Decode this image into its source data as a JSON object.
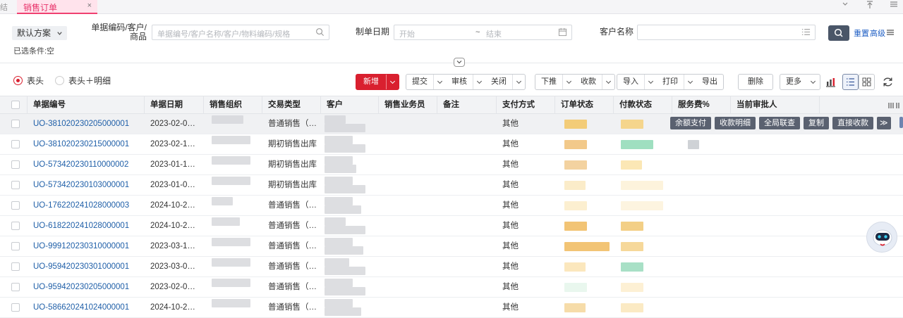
{
  "tabbar": {
    "prev_label": "结",
    "active_tab": "销售订单",
    "close": "×"
  },
  "filters": {
    "scheme": "默认方案",
    "selected_conditions": "已选条件:空",
    "code_label_1": "单据编码/客户/",
    "code_label_2": "商品",
    "code_placeholder": "单据编号/客户名称/客户/物料编码/规格",
    "date_label": "制单日期",
    "date_start": "开始",
    "date_sep": "~",
    "date_end": "结束",
    "customer_label": "客户名称",
    "customer_value": "",
    "reset": "重置",
    "advanced": "高级"
  },
  "toolbar": {
    "radio_header": "表头",
    "radio_header_detail": "表头＋明细",
    "new": "新增",
    "submit": "提交",
    "audit": "审核",
    "close": "关闭",
    "push_down": "下推",
    "collect": "收款",
    "import": "导入",
    "print": "打印",
    "export": "导出",
    "delete": "删除",
    "more": "更多"
  },
  "table": {
    "headers": [
      "单据编号",
      "单据日期",
      "销售组织",
      "交易类型",
      "客户",
      "销售业务员",
      "备注",
      "支付方式",
      "订单状态",
      "付款状态",
      "服务费%",
      "当前审批人"
    ],
    "rows": [
      {
        "code": "UO-381020230205000001",
        "date": "2023-02-0…",
        "type": "普通销售（…",
        "pay": "其他"
      },
      {
        "code": "UO-381020230215000001",
        "date": "2023-02-1…",
        "type": "期初销售出库",
        "pay": "其他"
      },
      {
        "code": "UO-573420230110000002",
        "date": "2023-01-1…",
        "type": "期初销售出库",
        "pay": "其他"
      },
      {
        "code": "UO-573420230103000001",
        "date": "2023-01-0…",
        "type": "期初销售出库",
        "pay": "其他"
      },
      {
        "code": "UO-176220241028000003",
        "date": "2024-10-2…",
        "type": "普通销售（…",
        "pay": "其他"
      },
      {
        "code": "UO-618220241028000001",
        "date": "2024-10-2…",
        "type": "普通销售（…",
        "pay": "其他"
      },
      {
        "code": "UO-999120230310000001",
        "date": "2023-03-1…",
        "type": "普通销售（…",
        "pay": "其他"
      },
      {
        "code": "UO-959420230301000001",
        "date": "2023-03-0…",
        "type": "普通销售（…",
        "pay": "其他"
      },
      {
        "code": "UO-959420230205000001",
        "date": "2023-02-0…",
        "type": "普通销售（…",
        "pay": "其他"
      },
      {
        "code": "UO-586620241024000001",
        "date": "2024-10-2…",
        "type": "普通销售（…",
        "pay": "其他"
      }
    ],
    "row_actions": [
      "余额支付",
      "收款明细",
      "全局联查",
      "复制",
      "直接收款",
      "≫"
    ]
  },
  "colors": {
    "accent_red": "#d9202f",
    "tab_pink": "#ffe3ec",
    "link_blue": "#1f5fa8",
    "action_gray": "#5a6170"
  }
}
